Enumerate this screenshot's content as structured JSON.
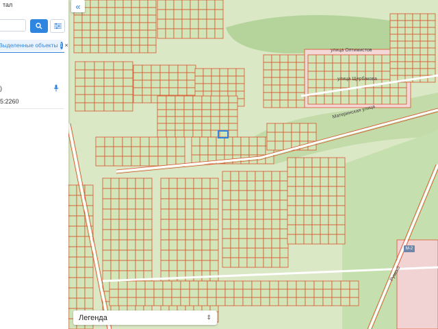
{
  "panel": {
    "portal_title": "тал",
    "search": {
      "value": "",
      "placeholder": ""
    },
    "search_icon": "search-icon",
    "filter_icon": "filter-icon",
    "selected_tab": {
      "label": "Выделенные объекты",
      "count": "1",
      "close": "×"
    },
    "info_line_1": ")",
    "info_line_2": "5:2260",
    "mic_icon": "microphone-icon"
  },
  "map": {
    "collapse_icon": "double-chevron-left-icon",
    "collapse_glyph": "«",
    "streets": {
      "optimistov": "улица Оптимистов",
      "sherbakova": "улица Щербакова",
      "materinskaya": "Материнская улица",
      "rumsko": "Румско"
    },
    "road_sign": "М-2",
    "colors": {
      "background": "#dbe8c6",
      "forest": "#b8d6a0",
      "parcel_fill": "#cfe3b6",
      "parcel_border": "#d9532b",
      "pink_block": "#f4d6d6",
      "road": "#ffffff",
      "selected": "#2f86e0"
    }
  },
  "legend": {
    "label": "Легенда",
    "toggle_glyph": "⇕"
  }
}
